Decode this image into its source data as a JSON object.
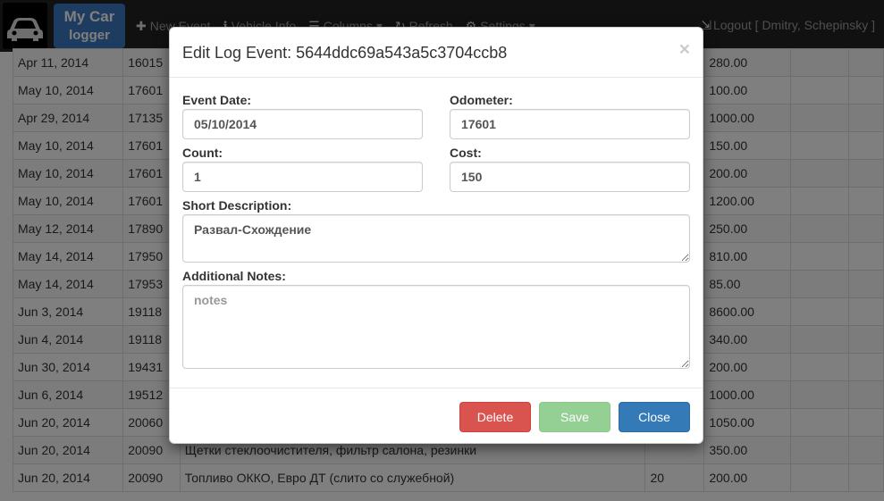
{
  "nav": {
    "brand_line1": "My Car",
    "brand_line2": "logger",
    "items": [
      {
        "label": "New Event",
        "icon": "plus-icon",
        "glyph": "✚"
      },
      {
        "label": "Vehicle Info",
        "icon": "info-icon",
        "glyph": "ℹ"
      },
      {
        "label": "Columns ▾",
        "icon": "list-icon",
        "glyph": "☰"
      },
      {
        "label": "Refresh",
        "icon": "refresh-icon",
        "glyph": "↻"
      },
      {
        "label": "Settings ▾",
        "icon": "gear-icon",
        "glyph": "⚙"
      }
    ],
    "logout": "Logout [ Dmitry, Schepinsky ]"
  },
  "table": {
    "rows": [
      [
        "Apr 11, 2014",
        "16015",
        "",
        "",
        "280.00"
      ],
      [
        "May 10, 2014",
        "17601",
        "",
        "",
        "100.00"
      ],
      [
        "Apr 29, 2014",
        "17135",
        "",
        "",
        "1000.00"
      ],
      [
        "May 10, 2014",
        "17601",
        "",
        "",
        "150.00"
      ],
      [
        "May 10, 2014",
        "17601",
        "",
        "",
        "200.00"
      ],
      [
        "May 10, 2014",
        "17601",
        "",
        "",
        "1200.00"
      ],
      [
        "May 12, 2014",
        "17890",
        "",
        "",
        "250.00"
      ],
      [
        "May 14, 2014",
        "17950",
        "",
        "",
        "810.00"
      ],
      [
        "May 14, 2014",
        "17953",
        "",
        "",
        "85.00"
      ],
      [
        "Jun 3, 2014",
        "19118",
        "",
        "",
        "8600.00"
      ],
      [
        "Jun 4, 2014",
        "19118",
        "",
        "",
        "340.00"
      ],
      [
        "Jun 30, 2014",
        "19431",
        "",
        "",
        "200.00"
      ],
      [
        "Jun 6, 2014",
        "19512",
        "",
        "",
        "1000.00"
      ],
      [
        "Jun 20, 2014",
        "20060",
        "",
        "",
        "1050.00"
      ],
      [
        "Jun 20, 2014",
        "20090",
        "Щетки стеклоочистителя, фильтр салона, резинки",
        "",
        "350.00"
      ],
      [
        "Jun 20, 2014",
        "20090",
        "Топливо ОККО, Евро ДТ (слито со служебной)",
        "20",
        "200.00"
      ]
    ]
  },
  "modal": {
    "title": "Edit Log Event: 5644ddc69a543a5c3704ccb8",
    "close_glyph": "×",
    "event_date_label": "Event Date:",
    "event_date_value": "05/10/2014",
    "odometer_label": "Odometer:",
    "odometer_value": "17601",
    "count_label": "Count:",
    "count_value": "1",
    "cost_label": "Cost:",
    "cost_value": "150",
    "short_desc_label": "Short Description:",
    "short_desc_value": "Развал-Схождение",
    "notes_label": "Additional Notes:",
    "notes_placeholder": "notes",
    "notes_value": "",
    "delete_label": "Delete",
    "save_label": "Save",
    "close_label": "Close"
  },
  "colors": {
    "navbar": "#222222",
    "brand": "#3a78bf",
    "delete": "#d9534f",
    "save": "#5cb85c",
    "close": "#337ab7"
  }
}
